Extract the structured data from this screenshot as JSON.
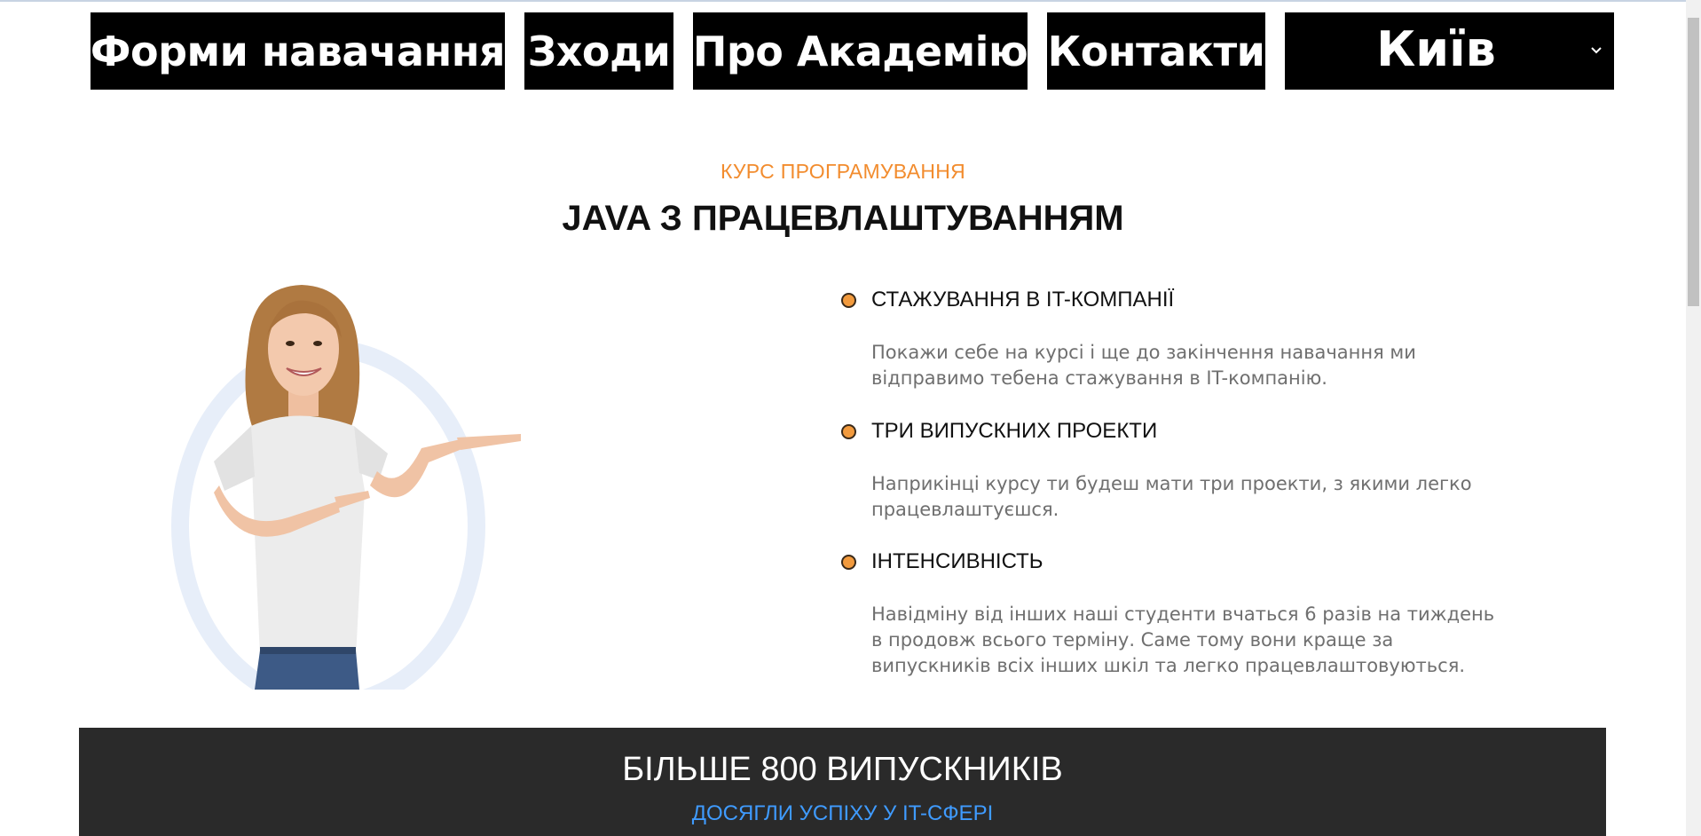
{
  "nav": {
    "items": [
      {
        "label": "Форми навачання"
      },
      {
        "label": "Зходи"
      },
      {
        "label": "Про Академію"
      },
      {
        "label": "Контакти"
      }
    ],
    "city": {
      "selected": "Київ",
      "icon": "chevron-down-icon"
    }
  },
  "hero": {
    "eyebrow": "КУРС ПРОГРАМУВАННЯ",
    "title": "JAVA З ПРАЦЕВЛАШТУВАННЯМ"
  },
  "features": [
    {
      "title": "СТАЖУВАННЯ В IT-КОМПАНІЇ",
      "lines": [
        "Покажи себе на курсі і ще до закінчення навачання ми",
        "відправимо тебена стажування в IT-компанію."
      ]
    },
    {
      "title": "ТРИ ВИПУСКНИХ ПРОЕКТИ",
      "lines": [
        "Наприкінці курсу ти будеш мати три проекти, з якими легко",
        "працевлаштуєшся."
      ]
    },
    {
      "title": "ІНТЕНСИВНІСТЬ",
      "lines": [
        "Навідміну від інших наші студенти вчаться 6 разів на тиждень",
        "в продовж всього терміну. Саме тому вони краще за",
        "випускників всіх інших шкіл та легко працевлаштовуються."
      ]
    }
  ],
  "stats": {
    "title": "БІЛЬШЕ 800 ВИПУСКНИКІВ",
    "subtitle": "ДОСЯГЛИ УСПІХУ У IT-СФЕРІ"
  },
  "colors": {
    "accent": "#f28c2e",
    "link": "#3f9bff",
    "nav_bg": "#000000",
    "band_bg": "#2a2a2a"
  }
}
